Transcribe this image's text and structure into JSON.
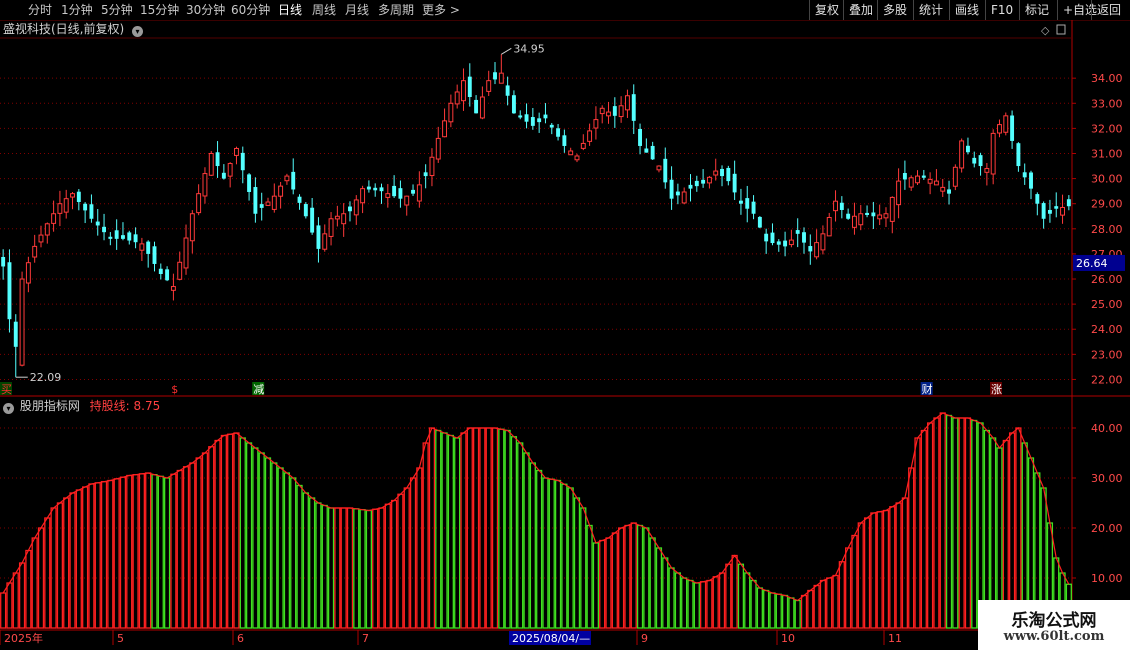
{
  "toolbar": {
    "periods": [
      "分时",
      "1分钟",
      "5分钟",
      "15分钟",
      "30分钟",
      "60分钟",
      "日线",
      "周线",
      "月线",
      "多周期",
      "更多 >"
    ],
    "active_period": "日线",
    "actions": [
      "复权",
      "叠加",
      "多股",
      "统计",
      "画线",
      "F10",
      "标记",
      "+自选",
      "返回"
    ]
  },
  "stock_title": "盛视科技(日线,前复权)",
  "indicator": {
    "name": "股朋指标网",
    "line_label": "持股线:",
    "line_value": "8.75"
  },
  "price_axis": {
    "labels": [
      "34.00",
      "33.00",
      "32.00",
      "31.00",
      "30.00",
      "29.00",
      "28.00",
      "27.00",
      "26.00",
      "25.00",
      "24.00",
      "23.00",
      "22.00"
    ],
    "ticks": [
      34,
      33,
      32,
      31,
      30,
      29,
      28,
      27,
      26,
      25,
      24,
      23,
      22
    ],
    "current_price": "26.64",
    "range": [
      21.5,
      35.6
    ]
  },
  "indicator_axis": {
    "labels": [
      "40.00",
      "30.00",
      "20.00",
      "10.00"
    ],
    "ticks": [
      40,
      30,
      20,
      10
    ],
    "range": [
      0,
      46
    ]
  },
  "price_high": {
    "value": 34.95,
    "label": "34.95"
  },
  "price_low": {
    "value": 22.09,
    "label": "22.09"
  },
  "date_axis": {
    "labels": [
      "2025年",
      "5",
      "6",
      "7",
      "9",
      "10",
      "11"
    ],
    "cursor_label": "2025/08/04/—"
  },
  "signals": [
    {
      "text": "买",
      "bar": 0,
      "color": "#ff3030",
      "bg": "#004400"
    },
    {
      "text": "$",
      "bar": 27,
      "color": "#ff3030",
      "bg": "#000000"
    },
    {
      "text": "减",
      "bar": 40,
      "color": "#ffffff",
      "bg": "#006600"
    },
    {
      "text": "财",
      "bar": 146,
      "color": "#ffffff",
      "bg": "#002288"
    },
    {
      "text": "涨",
      "bar": 157,
      "color": "#ffffff",
      "bg": "#660000"
    }
  ],
  "watermark": {
    "title": "乐淘公式网",
    "url": "www.60lt.com"
  },
  "colors": {
    "up": "#ff3a3a",
    "down": "#54ffff",
    "ind_red": "#ff2020",
    "ind_green": "#40e020",
    "grid": "#800000",
    "axis_text": "#ff4a4a"
  },
  "chart_data": [
    {
      "type": "candlestick",
      "title": "盛视科技(日线,前复权)",
      "ylim": [
        21.5,
        35.6
      ],
      "anchors": [
        [
          0,
          26.5
        ],
        [
          1,
          24.4
        ],
        [
          2,
          22.6
        ],
        [
          3,
          26.0
        ],
        [
          5,
          27.3
        ],
        [
          7,
          28.2
        ],
        [
          9,
          29.0
        ],
        [
          11,
          29.4
        ],
        [
          14,
          28.4
        ],
        [
          17,
          27.6
        ],
        [
          19,
          27.6
        ],
        [
          22,
          27.4
        ],
        [
          25,
          26.2
        ],
        [
          27,
          25.7
        ],
        [
          30,
          28.6
        ],
        [
          33,
          31.0
        ],
        [
          35,
          30.0
        ],
        [
          37,
          31.2
        ],
        [
          40,
          28.6
        ],
        [
          43,
          29.3
        ],
        [
          45,
          30.1
        ],
        [
          48,
          28.5
        ],
        [
          50,
          27.2
        ],
        [
          52,
          28.4
        ],
        [
          55,
          28.7
        ],
        [
          57,
          29.6
        ],
        [
          60,
          29.5
        ],
        [
          63,
          29.2
        ],
        [
          65,
          29.4
        ],
        [
          67,
          30.1
        ],
        [
          69,
          31.6
        ],
        [
          71,
          33.0
        ],
        [
          73,
          33.9
        ],
        [
          75,
          32.6
        ],
        [
          77,
          33.9
        ],
        [
          79,
          34.0
        ],
        [
          81,
          32.6
        ],
        [
          84,
          32.1
        ],
        [
          86,
          32.4
        ],
        [
          89,
          31.3
        ],
        [
          91,
          30.9
        ],
        [
          93,
          31.9
        ],
        [
          95,
          32.8
        ],
        [
          97,
          32.5
        ],
        [
          99,
          33.3
        ],
        [
          101,
          31.3
        ],
        [
          104,
          30.5
        ],
        [
          106,
          29.2
        ],
        [
          109,
          29.6
        ],
        [
          111,
          29.8
        ],
        [
          113,
          30.3
        ],
        [
          115,
          29.9
        ],
        [
          117,
          29.0
        ],
        [
          119,
          28.6
        ],
        [
          121,
          27.5
        ],
        [
          124,
          27.3
        ],
        [
          126,
          27.8
        ],
        [
          128,
          27.1
        ],
        [
          130,
          27.8
        ],
        [
          132,
          29.1
        ],
        [
          134,
          28.4
        ],
        [
          136,
          28.6
        ],
        [
          138,
          28.5
        ],
        [
          140,
          28.6
        ],
        [
          142,
          29.9
        ],
        [
          145,
          30.1
        ],
        [
          148,
          29.9
        ],
        [
          150,
          29.4
        ],
        [
          152,
          31.5
        ],
        [
          154,
          30.6
        ],
        [
          156,
          30.4
        ],
        [
          157,
          31.8
        ],
        [
          159,
          32.5
        ],
        [
          161,
          30.5
        ],
        [
          163,
          29.6
        ],
        [
          165,
          28.4
        ],
        [
          167,
          28.8
        ],
        [
          169,
          28.9
        ]
      ],
      "high": 34.95,
      "low": 22.09,
      "last": 26.64
    },
    {
      "type": "bar",
      "title": "股朋指标网",
      "series_name": "持股线",
      "last_value": 8.75,
      "ylim": [
        0,
        46
      ],
      "anchors": [
        [
          0,
          7
        ],
        [
          3,
          13
        ],
        [
          5,
          18
        ],
        [
          8,
          24
        ],
        [
          11,
          27
        ],
        [
          14,
          28.8
        ],
        [
          17,
          29.5
        ],
        [
          20,
          30.5
        ],
        [
          23,
          31
        ],
        [
          26,
          30
        ],
        [
          28,
          31.5
        ],
        [
          30,
          33
        ],
        [
          32,
          35
        ],
        [
          34,
          37.5
        ],
        [
          35,
          38.5
        ],
        [
          37,
          39
        ],
        [
          39,
          37
        ],
        [
          41,
          35
        ],
        [
          43,
          33
        ],
        [
          46,
          30
        ],
        [
          48,
          27
        ],
        [
          50,
          25
        ],
        [
          52,
          24
        ],
        [
          55,
          24
        ],
        [
          58,
          23.5
        ],
        [
          60,
          24
        ],
        [
          62,
          25.5
        ],
        [
          64,
          28
        ],
        [
          66,
          32
        ],
        [
          67,
          37
        ],
        [
          68,
          40
        ],
        [
          70,
          39
        ],
        [
          72,
          38
        ],
        [
          74,
          40
        ],
        [
          76,
          40
        ],
        [
          78,
          40
        ],
        [
          80,
          39.5
        ],
        [
          82,
          37
        ],
        [
          84,
          33
        ],
        [
          86,
          30
        ],
        [
          88,
          29.5
        ],
        [
          90,
          28
        ],
        [
          92,
          24
        ],
        [
          94,
          17
        ],
        [
          96,
          18
        ],
        [
          98,
          20
        ],
        [
          100,
          21
        ],
        [
          102,
          20
        ],
        [
          104,
          16
        ],
        [
          106,
          12
        ],
        [
          108,
          10
        ],
        [
          110,
          9
        ],
        [
          112,
          9.5
        ],
        [
          114,
          11
        ],
        [
          116,
          14.5
        ],
        [
          118,
          11
        ],
        [
          120,
          8
        ],
        [
          122,
          7
        ],
        [
          124,
          6.5
        ],
        [
          126,
          5.5
        ],
        [
          128,
          7.5
        ],
        [
          130,
          9.5
        ],
        [
          132,
          10.5
        ],
        [
          134,
          16
        ],
        [
          136,
          21
        ],
        [
          138,
          23
        ],
        [
          140,
          23.5
        ],
        [
          142,
          25
        ],
        [
          143,
          26
        ],
        [
          145,
          38
        ],
        [
          147,
          41
        ],
        [
          149,
          43
        ],
        [
          151,
          42
        ],
        [
          153,
          42
        ],
        [
          155,
          41
        ],
        [
          157,
          38
        ],
        [
          158,
          36
        ],
        [
          160,
          39
        ],
        [
          161,
          40
        ],
        [
          163,
          34
        ],
        [
          165,
          28
        ],
        [
          167,
          14
        ],
        [
          168,
          11
        ],
        [
          169,
          9
        ],
        [
          171,
          8.75
        ]
      ]
    }
  ]
}
